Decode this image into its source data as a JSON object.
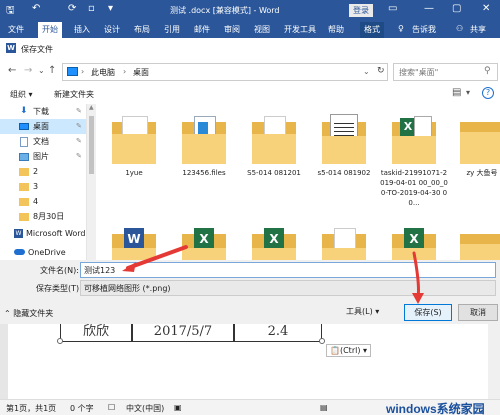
{
  "word": {
    "title": "测试 .docx [兼容模式] - Word",
    "login": "登录",
    "tabs": [
      "文件",
      "开始",
      "插入",
      "设计",
      "布局",
      "引用",
      "邮件",
      "审阅",
      "视图",
      "开发工具",
      "帮助",
      "格式"
    ],
    "tell_me": "告诉我",
    "share": "共享"
  },
  "dialog": {
    "title": "保存文件",
    "breadcrumb": [
      "此电脑",
      "桌面"
    ],
    "search_placeholder": "搜索\"桌面\"",
    "toolbar": {
      "organize": "组织 ▾",
      "new_folder": "新建文件夹"
    },
    "nav_items": [
      "下载",
      "桌面",
      "文档",
      "图片",
      "2",
      "3",
      "4",
      "8月30日",
      "Microsoft Word",
      "OneDrive"
    ],
    "files": [
      {
        "name": "1yue",
        "type": "folder-docs"
      },
      {
        "name": "123456.files",
        "type": "folder-docs"
      },
      {
        "name": "S5-014 081201",
        "type": "folder-docs"
      },
      {
        "name": "s5-014 081902",
        "type": "folder-docs"
      },
      {
        "name": "taskid-21991071-2019-04-01 00_00_00-TO-2019-04-30 00...",
        "type": "folder-excel"
      },
      {
        "name": "zy 大鱼号",
        "type": "folder"
      }
    ],
    "row2_files": [
      {
        "type": "folder-word"
      },
      {
        "type": "folder-excel"
      },
      {
        "type": "folder-excel"
      },
      {
        "type": "folder-docs"
      },
      {
        "type": "folder-excel"
      },
      {
        "type": "folder"
      }
    ],
    "filename_label": "文件名(N):",
    "filename_value": "测试123",
    "filetype_label": "保存类型(T):",
    "filetype_value": "可移植网络图形 (*.png)",
    "hide_folders": "隐藏文件夹",
    "tools": "工具(L)",
    "save": "保存(S)",
    "cancel": "取消"
  },
  "document": {
    "cells": [
      "欣欣",
      "2017/5/7",
      "2.4"
    ],
    "ctrl_tag": "(Ctrl) ▾"
  },
  "status": {
    "page": "第1页，共1页",
    "words": "0 个字",
    "lang": "中文(中国)"
  },
  "watermark": "windows系统家园",
  "colors": {
    "accent": "#2b579a",
    "arrow": "#e53935",
    "selected": "#cce8ff",
    "folder": "#f2c45a"
  }
}
